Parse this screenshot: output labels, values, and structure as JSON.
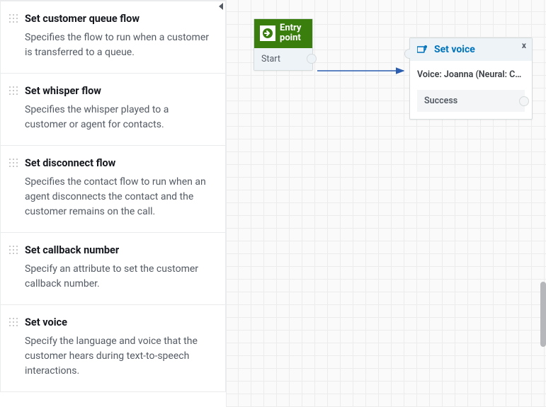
{
  "sidebar": {
    "blocks": [
      {
        "title": "Set customer queue flow",
        "desc": "Specifies the flow to run when a customer is transferred to a queue."
      },
      {
        "title": "Set whisper flow",
        "desc": "Specifies the whisper played to a customer or agent for contacts."
      },
      {
        "title": "Set disconnect flow",
        "desc": "Specifies the contact flow to run when an agent disconnects the contact and the customer remains on the call."
      },
      {
        "title": "Set callback number",
        "desc": "Specify an attribute to set the customer callback number."
      },
      {
        "title": "Set voice",
        "desc": "Specify the language and voice that the customer hears during text-to-speech interactions."
      }
    ]
  },
  "canvas": {
    "entry": {
      "label": "Entry point",
      "start": "Start"
    },
    "voiceNode": {
      "title": "Set voice",
      "body": "Voice: Joanna (Neural: Co...",
      "success": "Success",
      "close": "x"
    }
  }
}
